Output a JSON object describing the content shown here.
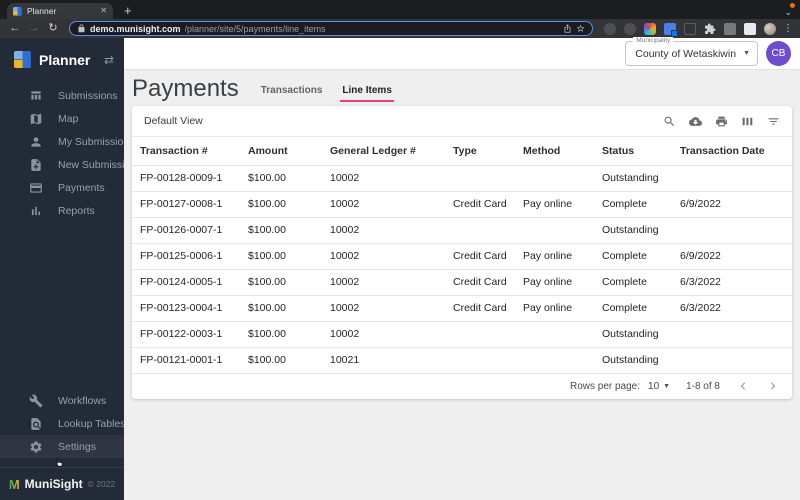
{
  "browser": {
    "tab": {
      "title": "Planner"
    },
    "url": {
      "host": "demo.munisight.com",
      "path": "/planner/site/5/payments/line_items"
    }
  },
  "sidebar": {
    "app_name": "Planner",
    "items": [
      {
        "label": "Submissions",
        "icon": "submissions-icon"
      },
      {
        "label": "Map",
        "icon": "map-icon"
      },
      {
        "label": "My Submissions",
        "icon": "person-icon"
      },
      {
        "label": "New Submission",
        "icon": "new-submission-icon"
      },
      {
        "label": "Payments",
        "icon": "payments-icon"
      },
      {
        "label": "Reports",
        "icon": "reports-icon"
      }
    ],
    "bottom_items": [
      {
        "label": "Workflows",
        "icon": "wrench-icon"
      },
      {
        "label": "Lookup Tables",
        "icon": "lookup-icon"
      },
      {
        "label": "Settings",
        "icon": "gear-icon",
        "hover": true
      }
    ],
    "footer": {
      "brand": "MuniSight",
      "copyright": "© 2022"
    }
  },
  "header": {
    "municipality": {
      "label": "Municipality",
      "value": "County of Wetaskiwin"
    },
    "avatar_initials": "CB"
  },
  "main": {
    "title": "Payments",
    "tabs": [
      {
        "label": "Transactions",
        "active": false
      },
      {
        "label": "Line Items",
        "active": true
      }
    ],
    "view_label": "Default View",
    "toolbar_icons": [
      "search-icon",
      "cloud-download-icon",
      "print-icon",
      "columns-icon",
      "filter-icon"
    ],
    "table": {
      "columns": [
        "Transaction #",
        "Amount",
        "General Ledger #",
        "Type",
        "Method",
        "Status",
        "Transaction Date"
      ],
      "rows": [
        [
          "FP-00128-0009-1",
          "$100.00",
          "10002",
          "",
          "",
          "Outstanding",
          ""
        ],
        [
          "FP-00127-0008-1",
          "$100.00",
          "10002",
          "Credit Card",
          "Pay online",
          "Complete",
          "6/9/2022"
        ],
        [
          "FP-00126-0007-1",
          "$100.00",
          "10002",
          "",
          "",
          "Outstanding",
          ""
        ],
        [
          "FP-00125-0006-1",
          "$100.00",
          "10002",
          "Credit Card",
          "Pay online",
          "Complete",
          "6/9/2022"
        ],
        [
          "FP-00124-0005-1",
          "$100.00",
          "10002",
          "Credit Card",
          "Pay online",
          "Complete",
          "6/3/2022"
        ],
        [
          "FP-00123-0004-1",
          "$100.00",
          "10002",
          "Credit Card",
          "Pay online",
          "Complete",
          "6/3/2022"
        ],
        [
          "FP-00122-0003-1",
          "$100.00",
          "10002",
          "",
          "",
          "Outstanding",
          ""
        ],
        [
          "FP-00121-0001-1",
          "$100.00",
          "10021",
          "",
          "",
          "Outstanding",
          ""
        ]
      ]
    },
    "pagination": {
      "rows_per_page_label": "Rows per page:",
      "rows_per_page_value": "10",
      "range": "1-8 of 8"
    }
  },
  "colors": {
    "accent_pink": "#ec407a",
    "avatar_purple": "#6f4bcd",
    "sidebar_bg": "#242b38"
  }
}
